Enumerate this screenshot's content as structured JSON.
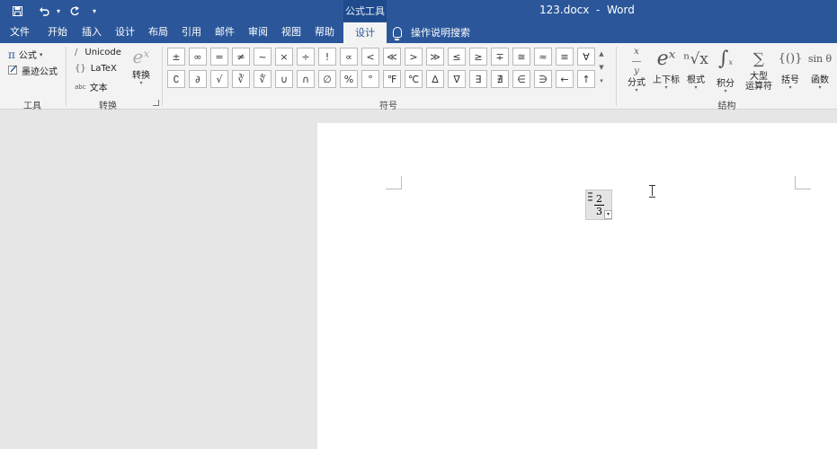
{
  "app": {
    "document_title": "123.docx  -  Word",
    "contextual_tab_group": "公式工具"
  },
  "tabs": [
    {
      "label": "文件"
    },
    {
      "label": "开始"
    },
    {
      "label": "插入"
    },
    {
      "label": "设计"
    },
    {
      "label": "布局"
    },
    {
      "label": "引用"
    },
    {
      "label": "邮件"
    },
    {
      "label": "审阅"
    },
    {
      "label": "视图"
    },
    {
      "label": "帮助"
    },
    {
      "label": "设计"
    }
  ],
  "tell_me": "操作说明搜索",
  "ribbon": {
    "tools": {
      "label": "工具",
      "equation_label": "公式",
      "ink_equation_label": "墨迹公式"
    },
    "conversions": {
      "label": "转换",
      "unicode_label": "Unicode",
      "latex_label": "LaTeX",
      "text_label": "文本",
      "text_icon_text": "abc",
      "convert_label": "转换"
    },
    "symbols": {
      "label": "符号",
      "row1": [
        "±",
        "∞",
        "=",
        "≠",
        "~",
        "×",
        "÷",
        "!",
        "∝",
        "<",
        "≪",
        ">",
        "≫",
        "≤",
        "≥",
        "∓",
        "≅",
        "≈",
        "≡",
        "∀"
      ],
      "row2": [
        "∁",
        "∂",
        "√",
        "∛",
        "∜",
        "∪",
        "∩",
        "∅",
        "%",
        "°",
        "℉",
        "℃",
        "∆",
        "∇",
        "∃",
        "∄",
        "∈",
        "∋",
        "←",
        "↑"
      ]
    },
    "structures": {
      "label": "结构",
      "items": [
        {
          "label": "分式",
          "glyph": "x/y"
        },
        {
          "label": "上下标",
          "glyph": "eˣ"
        },
        {
          "label": "根式",
          "glyph": "ⁿ√x"
        },
        {
          "label": "积分",
          "glyph": "∫"
        },
        {
          "label": "大型",
          "label2": "运算符",
          "glyph": "∑"
        },
        {
          "label": "括号",
          "glyph": "{()}"
        },
        {
          "label": "函数",
          "glyph": "sin θ"
        }
      ]
    }
  },
  "document": {
    "equation": {
      "numerator": "2",
      "denominator": "3"
    }
  },
  "colors": {
    "brand": "#2b579a",
    "ribbon_bg": "#f3f3f3",
    "canvas_bg": "#e6e6e6"
  }
}
